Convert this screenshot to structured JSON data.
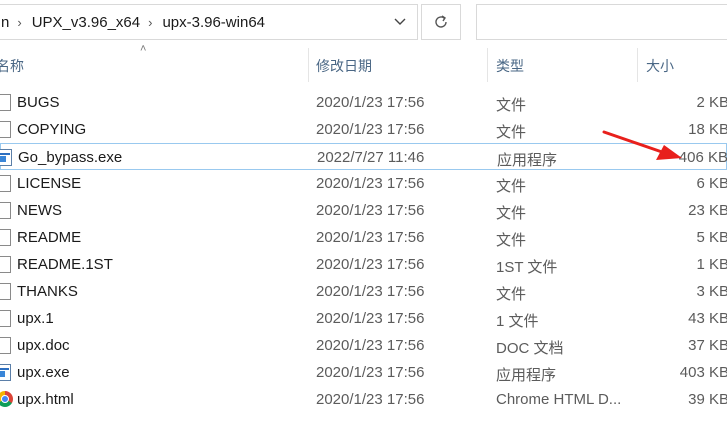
{
  "address": {
    "crumbs": [
      "n",
      "UPX_v3.96_x64",
      "upx-3.96-win64"
    ]
  },
  "columns": {
    "name": "名称",
    "date": "修改日期",
    "type": "类型",
    "size": "大小"
  },
  "files": [
    {
      "name": "BUGS",
      "date": "2020/1/23 17:56",
      "type": "文件",
      "size": "2 KB",
      "icon": "file-icon"
    },
    {
      "name": "COPYING",
      "date": "2020/1/23 17:56",
      "type": "文件",
      "size": "18 KB",
      "icon": "file-icon"
    },
    {
      "name": "Go_bypass.exe",
      "date": "2022/7/27 11:46",
      "type": "应用程序",
      "size": "406 KB",
      "icon": "exe-icon"
    },
    {
      "name": "LICENSE",
      "date": "2020/1/23 17:56",
      "type": "文件",
      "size": "6 KB",
      "icon": "file-icon"
    },
    {
      "name": "NEWS",
      "date": "2020/1/23 17:56",
      "type": "文件",
      "size": "23 KB",
      "icon": "file-icon"
    },
    {
      "name": "README",
      "date": "2020/1/23 17:56",
      "type": "文件",
      "size": "5 KB",
      "icon": "file-icon"
    },
    {
      "name": "README.1ST",
      "date": "2020/1/23 17:56",
      "type": "1ST 文件",
      "size": "1 KB",
      "icon": "file-icon"
    },
    {
      "name": "THANKS",
      "date": "2020/1/23 17:56",
      "type": "文件",
      "size": "3 KB",
      "icon": "file-icon"
    },
    {
      "name": "upx.1",
      "date": "2020/1/23 17:56",
      "type": "1 文件",
      "size": "43 KB",
      "icon": "file-icon"
    },
    {
      "name": "upx.doc",
      "date": "2020/1/23 17:56",
      "type": "DOC 文档",
      "size": "37 KB",
      "icon": "file-icon"
    },
    {
      "name": "upx.exe",
      "date": "2020/1/23 17:56",
      "type": "应用程序",
      "size": "403 KB",
      "icon": "exe-icon"
    },
    {
      "name": "upx.html",
      "date": "2020/1/23 17:56",
      "type": "Chrome HTML D...",
      "size": "39 KB",
      "icon": "chrome-icon"
    }
  ],
  "annotation_color": "#e8201c"
}
